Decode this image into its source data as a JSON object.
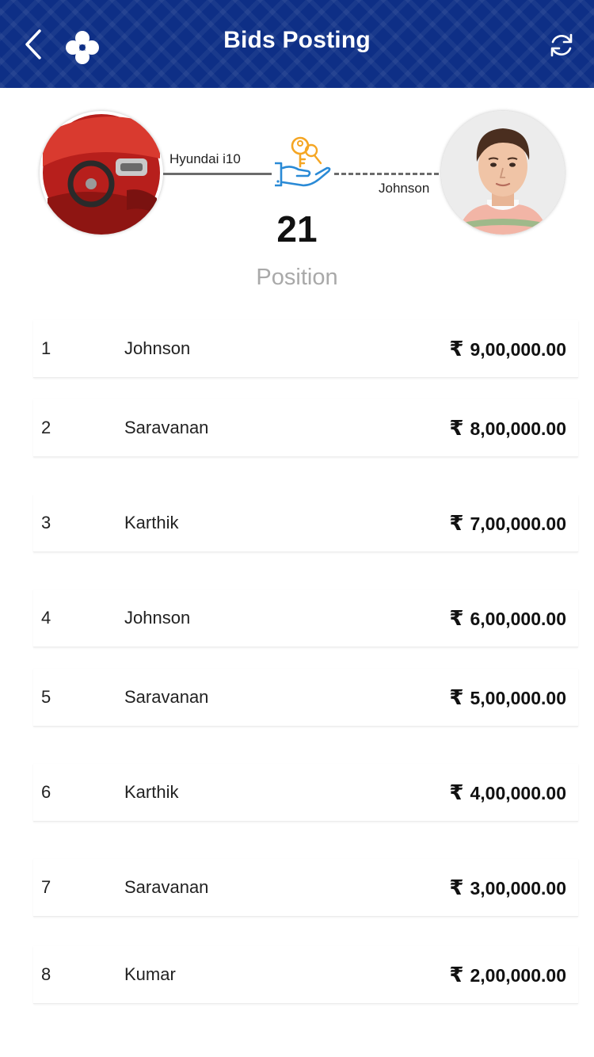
{
  "header": {
    "title": "Bids Posting",
    "back_icon": "chevron-left-icon",
    "logo_icon": "four-petal-logo-icon",
    "refresh_icon": "refresh-icon",
    "background_color": "#0e2f86"
  },
  "deal": {
    "car_name": "Hyundai i10",
    "buyer_name": "Johnson",
    "position_number": "21",
    "position_label": "Position",
    "handshake_icon": "key-handover-icon",
    "icon_colors": {
      "key": "#f5a623",
      "hand": "#2a8ad6"
    }
  },
  "bids": [
    {
      "rank": "1",
      "name": "Johnson",
      "currency": "₹",
      "amount": "9,00,000.00"
    },
    {
      "rank": "2",
      "name": "Saravanan",
      "currency": "₹",
      "amount": "8,00,000.00"
    },
    {
      "rank": "3",
      "name": "Karthik",
      "currency": "₹",
      "amount": "7,00,000.00"
    },
    {
      "rank": "4",
      "name": "Johnson",
      "currency": "₹",
      "amount": "6,00,000.00"
    },
    {
      "rank": "5",
      "name": "Saravanan",
      "currency": "₹",
      "amount": "5,00,000.00"
    },
    {
      "rank": "6",
      "name": "Karthik",
      "currency": "₹",
      "amount": "4,00,000.00"
    },
    {
      "rank": "7",
      "name": "Saravanan",
      "currency": "₹",
      "amount": "3,00,000.00"
    },
    {
      "rank": "8",
      "name": "Kumar",
      "currency": "₹",
      "amount": "2,00,000.00"
    }
  ]
}
